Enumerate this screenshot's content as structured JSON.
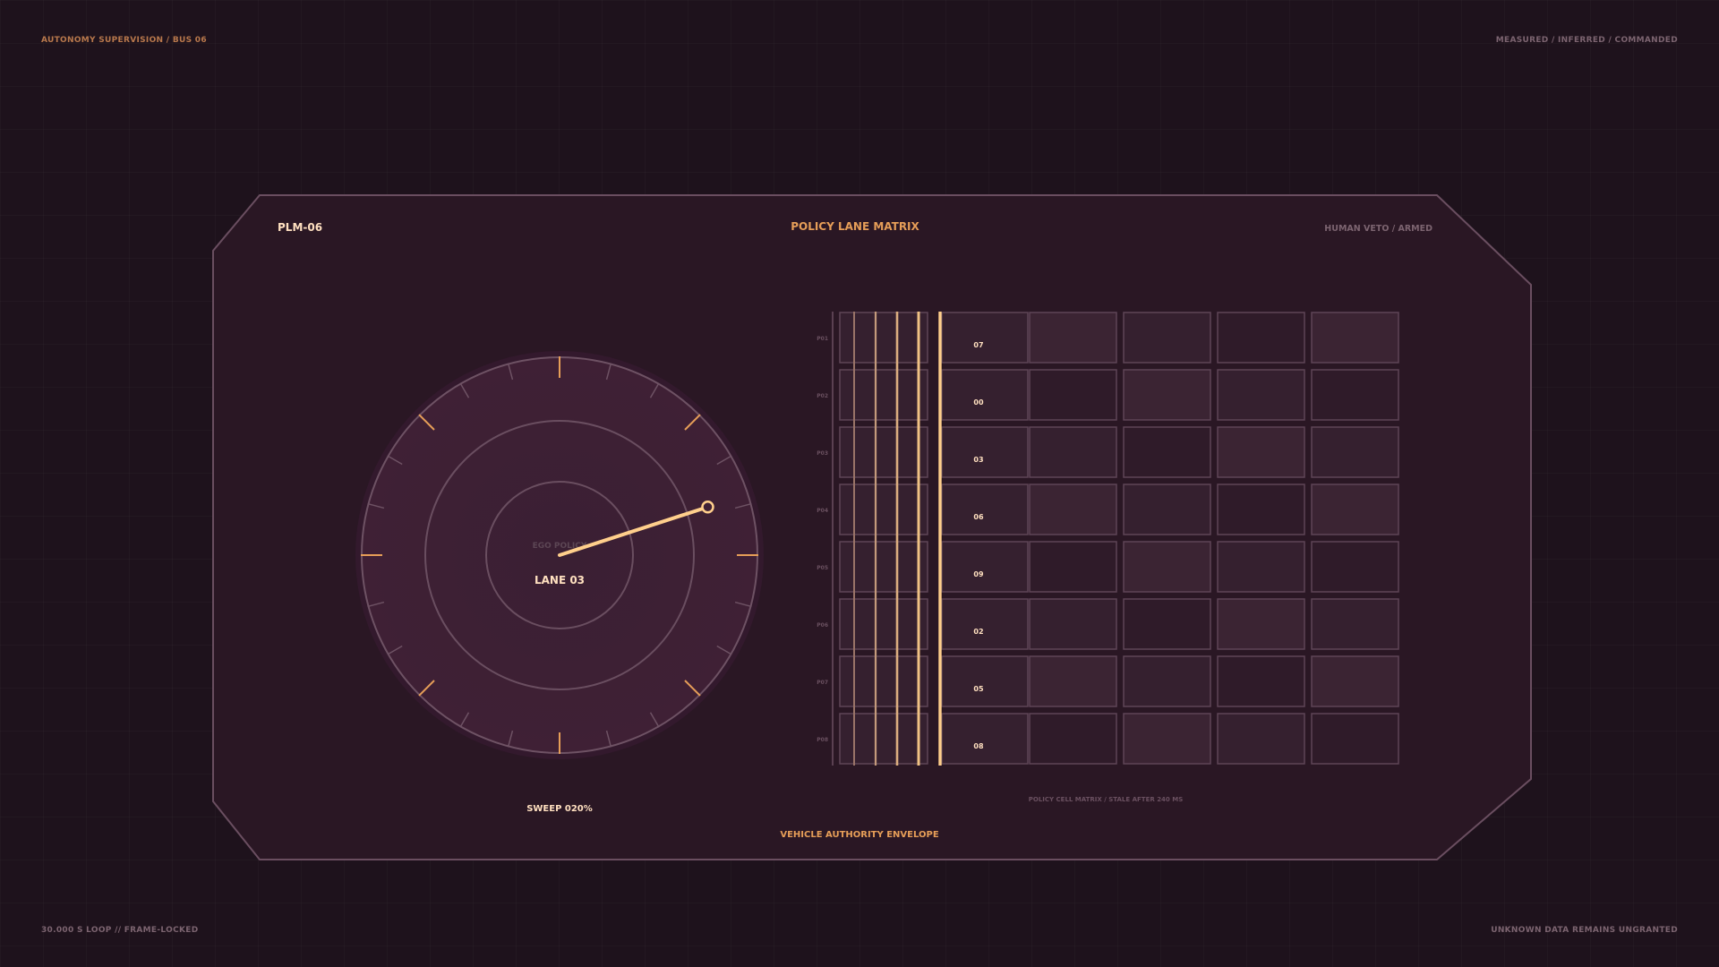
{
  "corners": {
    "top_left": "AUTONOMY SUPERVISION / BUS 06",
    "top_right": "MEASURED  /  INFERRED  /  COMMANDED",
    "bottom_left": "30.000 S LOOP  //  FRAME-LOCKED",
    "bottom_right": "UNKNOWN DATA REMAINS UNGRANTED"
  },
  "panel": {
    "id": "PLM-06",
    "title": "POLICY LANE MATRIX",
    "status": "HUMAN VETO / ARMED",
    "footer": "VEHICLE AUTHORITY ENVELOPE"
  },
  "dial": {
    "caption": "EGO POLICY",
    "lane": "LANE 03",
    "sweep_label": "SWEEP 020%",
    "sweep_fraction": 0.2
  },
  "matrix": {
    "row_labels": [
      "P01",
      "P02",
      "P03",
      "P04",
      "P05",
      "P06",
      "P07",
      "P08"
    ],
    "values": [
      "07",
      "00",
      "03",
      "06",
      "09",
      "02",
      "05",
      "08"
    ],
    "footer": "POLICY CELL MATRIX / STALE AFTER 240 MS",
    "data_columns": 4
  },
  "colors": {
    "accent": "#ffcf8c",
    "orange": "#e69e58",
    "muted": "#7c6470",
    "panel": "#2c1826",
    "border": "#6a4e60"
  }
}
